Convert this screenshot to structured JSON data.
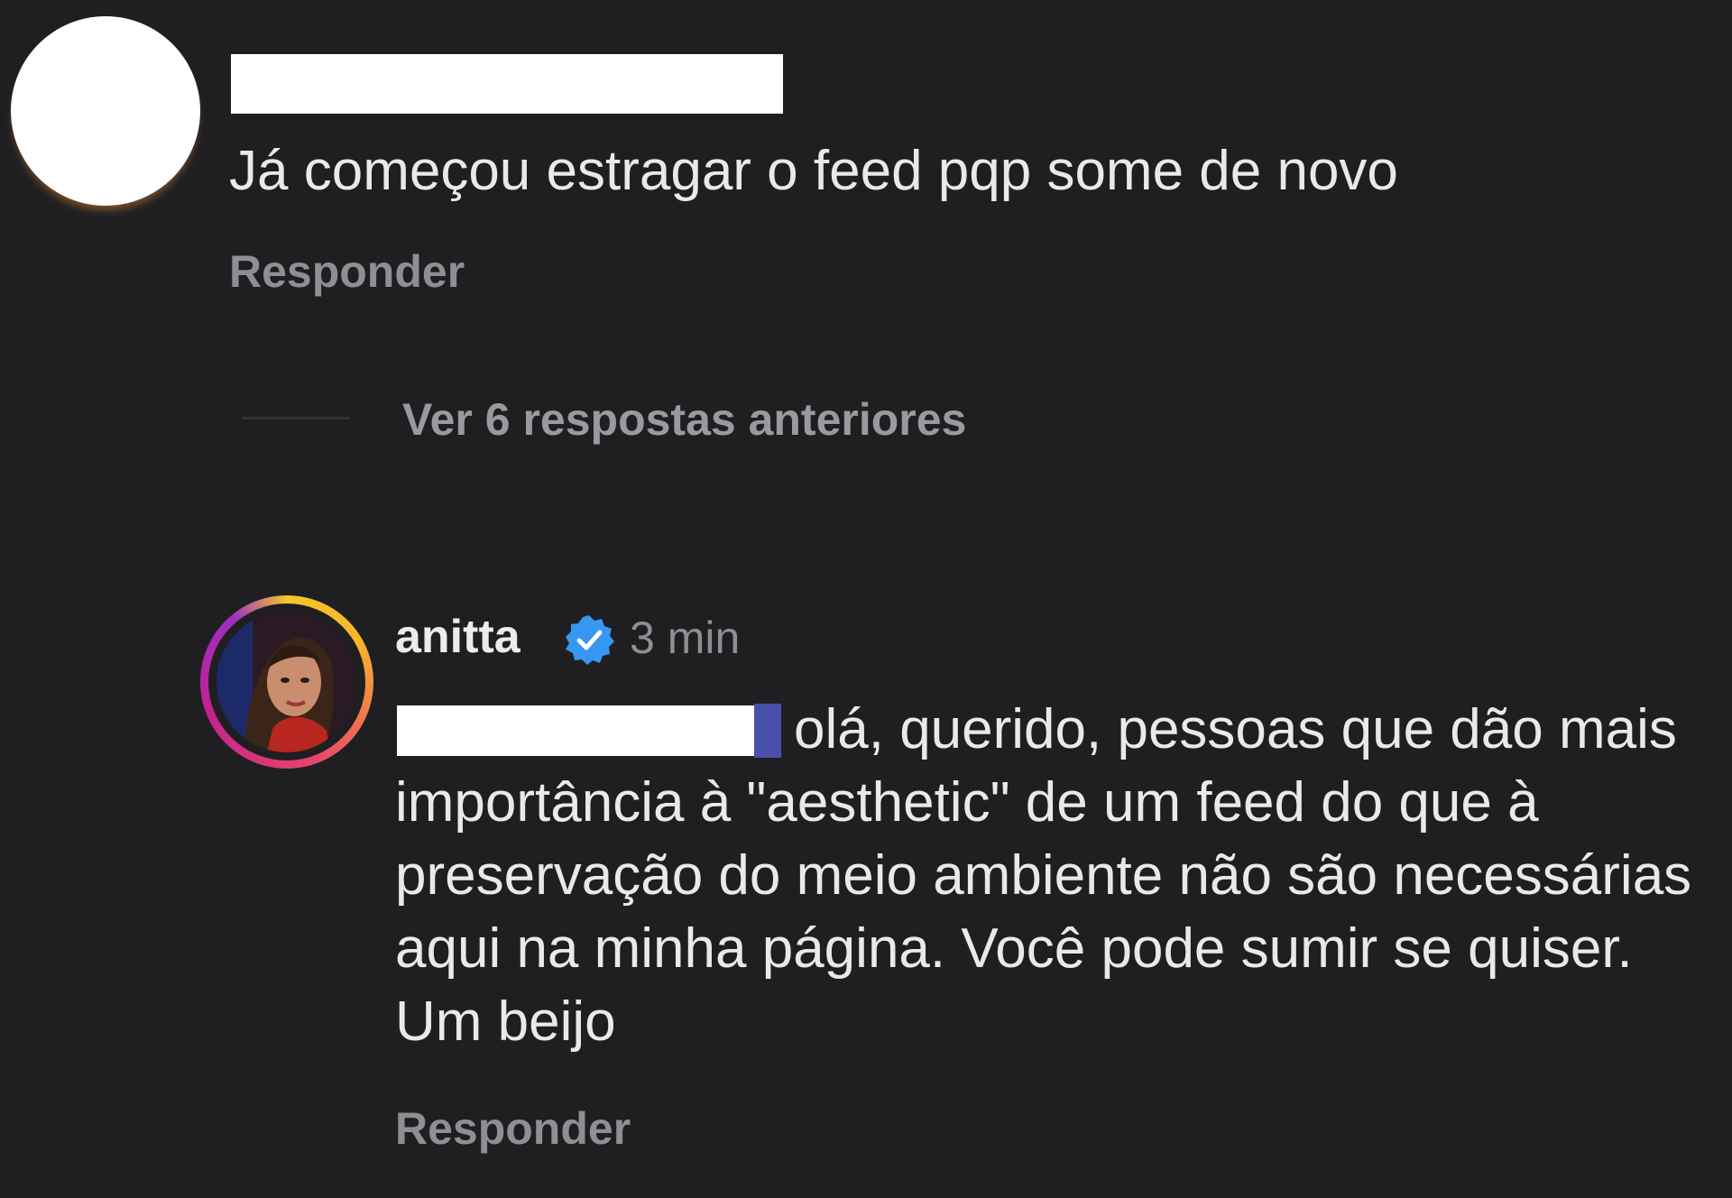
{
  "comment": {
    "text": "Já começou estragar o feed pqp some de novo",
    "reply_label": "Responder"
  },
  "view_replies_label": "Ver 6 respostas anteriores",
  "reply": {
    "username": "anitta",
    "verified": true,
    "timestamp": "3 min",
    "text": "olá, querido, pessoas que dão mais importância à \"aesthetic\" de um feed do que à preservação do meio ambiente não são necessárias aqui na minha página. Você pode sumir se quiser. Um beijo",
    "reply_label": "Responder"
  },
  "colors": {
    "background": "#1f1f22",
    "verified_badge": "#3897f0",
    "muted_text": "#8f8f93"
  },
  "icons": {
    "verified": "verified-badge-icon"
  }
}
